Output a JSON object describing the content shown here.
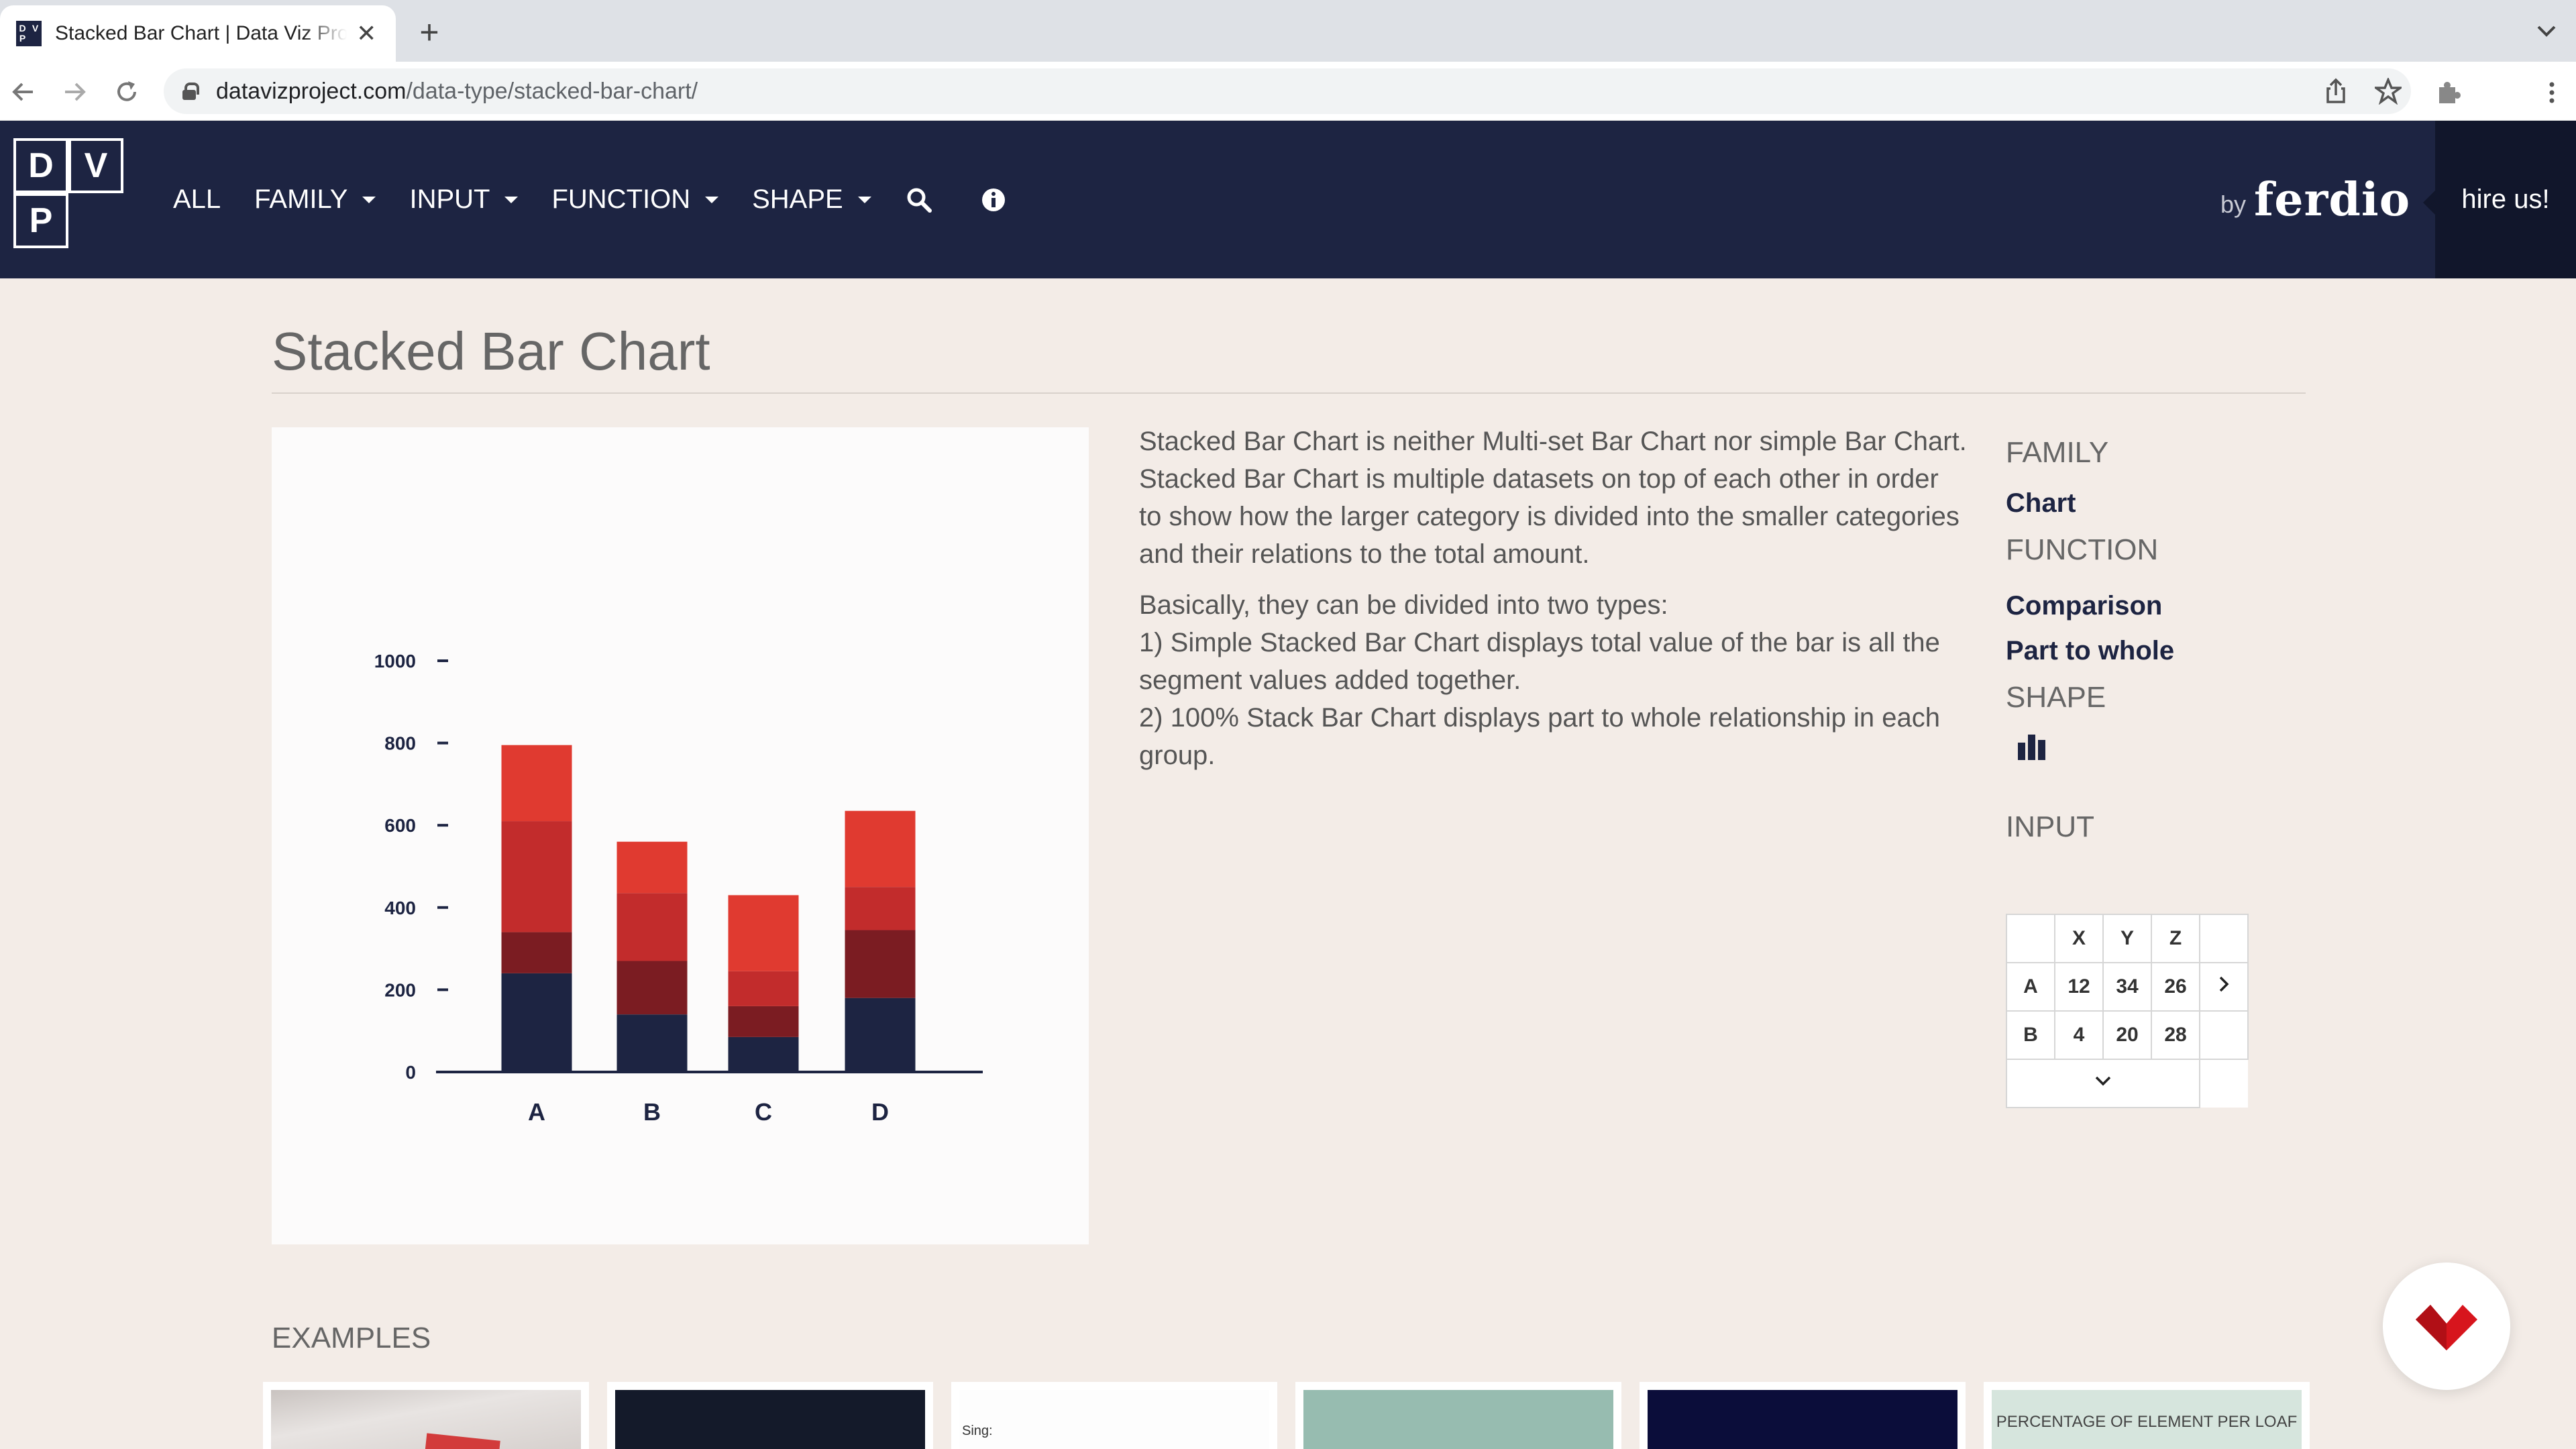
{
  "browser": {
    "tab_title": "Stacked Bar Chart | Data Viz Project",
    "url_host": "datavizproject.com",
    "url_path": "/data-type/stacked-bar-chart/"
  },
  "site": {
    "logo_letters": [
      "D",
      "V",
      "P"
    ],
    "menu": [
      "ALL",
      "FAMILY",
      "INPUT",
      "FUNCTION",
      "SHAPE"
    ],
    "by": "by",
    "brand": "ferdio",
    "hire": "hire us!"
  },
  "page": {
    "title": "Stacked Bar Chart",
    "paragraphs": [
      "Stacked Bar Chart is neither Multi-set Bar Chart nor simple Bar Chart. Stacked Bar Chart is multiple datasets on top of each other in order to show how the larger category is divided into the smaller categories and their relations to the total amount.",
      "Basically, they can be divided into two types:",
      "1) Simple Stacked Bar Chart displays total value of the bar is all the segment values added together.",
      "2) 100% Stack Bar Chart displays part to whole relationship in each group."
    ],
    "side": {
      "family_label": "FAMILY",
      "family": "Chart",
      "function_label": "FUNCTION",
      "functions": [
        "Comparison",
        "Part to whole"
      ],
      "shape_label": "SHAPE",
      "input_label": "INPUT"
    },
    "input_table": {
      "headers": [
        "X",
        "Y",
        "Z"
      ],
      "rows": [
        {
          "label": "A",
          "values": [
            "12",
            "34",
            "26"
          ]
        },
        {
          "label": "B",
          "values": [
            "4",
            "20",
            "28"
          ]
        }
      ]
    },
    "examples_label": "EXAMPLES",
    "example_texts": [
      "Sing:",
      "PERCENTAGE OF ELEMENT PER LOAF"
    ]
  },
  "colors": {
    "navy": "#1d2442",
    "dark_red": "#7b1c22",
    "red": "#c22c2c",
    "light_red": "#e03a30",
    "background": "#f3ece7"
  },
  "chart_data": {
    "type": "bar",
    "stacked": true,
    "categories": [
      "A",
      "B",
      "C",
      "D"
    ],
    "ylim": [
      0,
      1000
    ],
    "yticks": [
      0,
      200,
      400,
      600,
      800,
      1000
    ],
    "series": [
      {
        "color": "#1d2442",
        "values": [
          240,
          140,
          85,
          180
        ]
      },
      {
        "color": "#7b1c22",
        "values": [
          100,
          130,
          75,
          165
        ]
      },
      {
        "color": "#c22c2c",
        "values": [
          270,
          165,
          85,
          105
        ]
      },
      {
        "color": "#e03a30",
        "values": [
          185,
          125,
          185,
          185
        ]
      }
    ]
  }
}
